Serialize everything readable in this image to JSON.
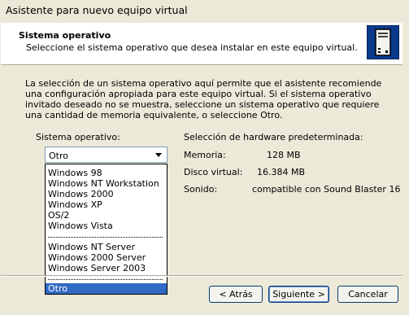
{
  "window": {
    "title": "Asistente para nuevo equipo virtual"
  },
  "header": {
    "title": "Sistema operativo",
    "subtitle": "Seleccione el sistema operativo que desea instalar en este equipo virtual.",
    "icon": "computer-tower-icon"
  },
  "intro_text": "La selección de un sistema operativo aquí permite que el asistente recomiende una configuración apropiada para este equipo virtual. Si el sistema operativo invitado deseado no se muestra, seleccione un sistema operativo que requiere una cantidad de memoria equivalente, o seleccione Otro.",
  "os_select": {
    "label": "Sistema operativo:",
    "value": "Otro",
    "groups": [
      [
        "Windows 98",
        "Windows NT Workstation",
        "Windows 2000",
        "Windows XP",
        "OS/2",
        "Windows Vista"
      ],
      [
        "Windows NT Server",
        "Windows 2000 Server",
        "Windows Server 2003"
      ],
      [
        "Otro"
      ]
    ],
    "selected": "Otro"
  },
  "hardware": {
    "heading": "Selección de hardware predeterminada:",
    "memory_label": "Memoria:",
    "memory_value": "128 MB",
    "disk_label": "Disco virtual:",
    "disk_value": "16.384 MB",
    "sound_label": "Sonido:",
    "sound_value": "compatible con Sound Blaster 16"
  },
  "buttons": {
    "back": "< Atrás",
    "next": "Siguiente >",
    "cancel": "Cancelar"
  },
  "colors": {
    "selection": "#316ac5",
    "face": "#ece9d8"
  }
}
